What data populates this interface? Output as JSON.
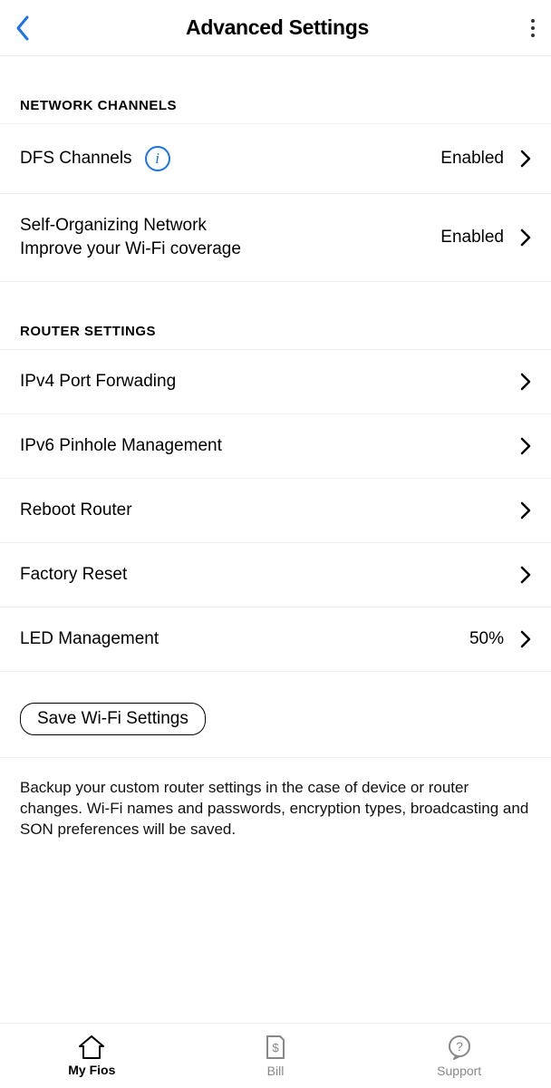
{
  "header": {
    "title": "Advanced Settings"
  },
  "sections": {
    "network": {
      "title": "NETWORK CHANNELS",
      "dfs": {
        "label": "DFS Channels",
        "value": "Enabled"
      },
      "son": {
        "label": "Self-Organizing Network",
        "sub": "Improve your Wi-Fi coverage",
        "value": "Enabled"
      }
    },
    "router": {
      "title": "ROUTER SETTINGS",
      "ipv4": {
        "label": "IPv4 Port Forwading"
      },
      "ipv6": {
        "label": "IPv6 Pinhole Management"
      },
      "reboot": {
        "label": "Reboot Router"
      },
      "factory": {
        "label": "Factory Reset"
      },
      "led": {
        "label": "LED Management",
        "value": "50%"
      }
    }
  },
  "save_button": "Save Wi-Fi Settings",
  "description": "Backup your custom router settings in the case of device or router changes. Wi-Fi names and passwords, encryption types, broadcasting and SON preferences will be saved.",
  "nav": {
    "myfios": "My Fios",
    "bill": "Bill",
    "support": "Support"
  }
}
